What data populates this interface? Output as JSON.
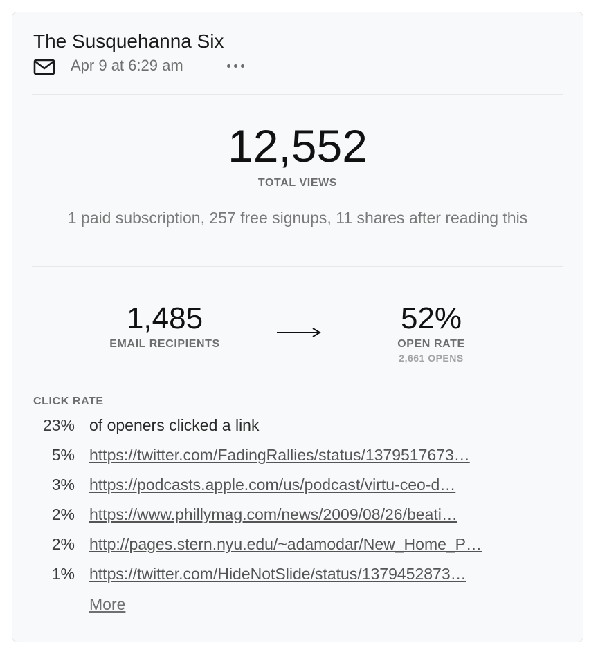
{
  "post": {
    "title": "The Susquehanna Six",
    "date": "Apr 9 at 6:29 am",
    "icons": {
      "type": "mail-icon",
      "menu": "more-dots-icon"
    }
  },
  "views": {
    "total": "12,552",
    "label": "TOTAL VIEWS",
    "summary": "1 paid subscription, 257 free signups, 11 shares after reading this"
  },
  "email": {
    "recipients": "1,485",
    "recipients_label": "EMAIL RECIPIENTS",
    "open_rate": "52%",
    "open_rate_label": "OPEN RATE",
    "opens": "2,661 OPENS"
  },
  "clicks": {
    "heading": "CLICK RATE",
    "overall_pct": "23%",
    "overall_text": "of openers clicked a link",
    "links": [
      {
        "pct": "5%",
        "url": "https://twitter.com/FadingRallies/status/1379517673…"
      },
      {
        "pct": "3%",
        "url": "https://podcasts.apple.com/us/podcast/virtu-ceo-d…"
      },
      {
        "pct": "2%",
        "url": "https://www.phillymag.com/news/2009/08/26/beati…"
      },
      {
        "pct": "2%",
        "url": "http://pages.stern.nyu.edu/~adamodar/New_Home_P…"
      },
      {
        "pct": "1%",
        "url": "https://twitter.com/HideNotSlide/status/1379452873…"
      }
    ],
    "more_label": "More"
  }
}
